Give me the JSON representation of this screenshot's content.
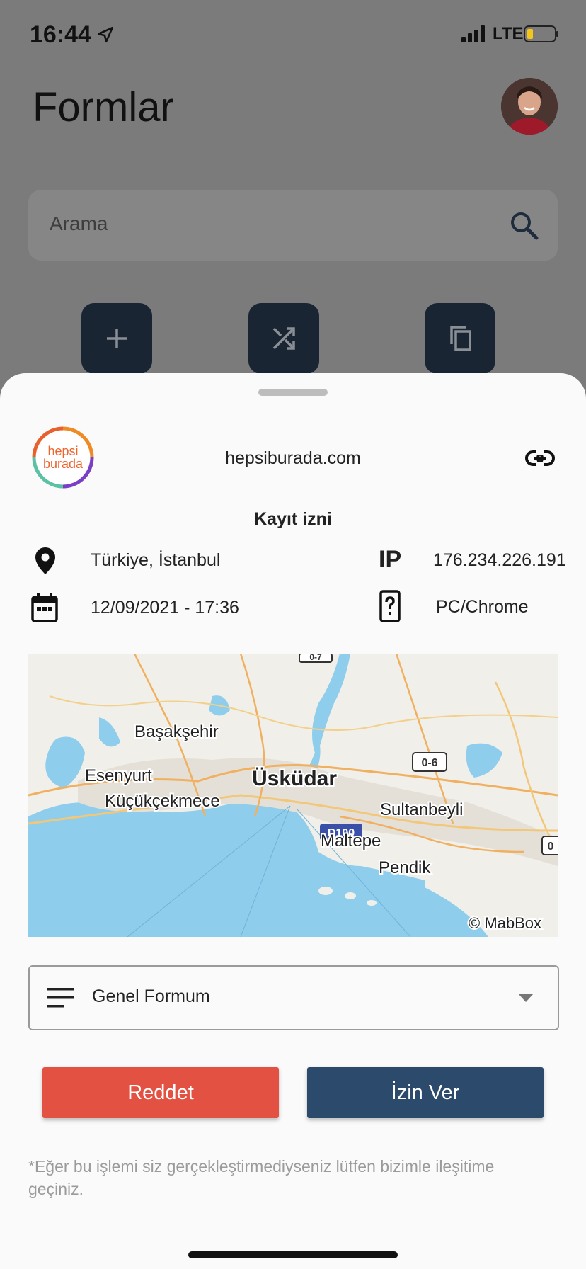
{
  "status_bar": {
    "time": "16:44",
    "network": "LTE",
    "battery_color": "#f5c518"
  },
  "header": {
    "title": "Formlar"
  },
  "search": {
    "placeholder": "Arama"
  },
  "actions": [
    {
      "icon": "plus-icon"
    },
    {
      "icon": "shuffle-icon"
    },
    {
      "icon": "copy-icon"
    }
  ],
  "sheet": {
    "logo_text_line1": "hepsi",
    "logo_text_line2": "burada",
    "domain": "hepsiburada.com",
    "heading": "Kayıt izni",
    "location": "Türkiye, İstanbul",
    "ip_label": "IP",
    "ip": "176.234.226.191",
    "datetime": "12/09/2021 - 17:36",
    "device": "PC/Chrome",
    "map": {
      "labels": [
        "Başakşehir",
        "Esenyurt",
        "Küçükçekmece",
        "Üsküdar",
        "Sultanbeyli",
        "Maltepe",
        "Pendik"
      ],
      "road_labels": [
        "0-6",
        "D100",
        "0-7",
        "0"
      ],
      "attribution": "© MabBox"
    },
    "form_select": "Genel Formum",
    "reject_label": "Reddet",
    "allow_label": "İzin Ver",
    "note": "*Eğer bu işlemi siz gerçekleştirmediyseniz lütfen bizimle ileşitime geçiniz."
  },
  "colors": {
    "reject": "#e35142",
    "allow": "#2c4a6b",
    "action_bg": "#1a2533",
    "water": "#8fcdec"
  }
}
